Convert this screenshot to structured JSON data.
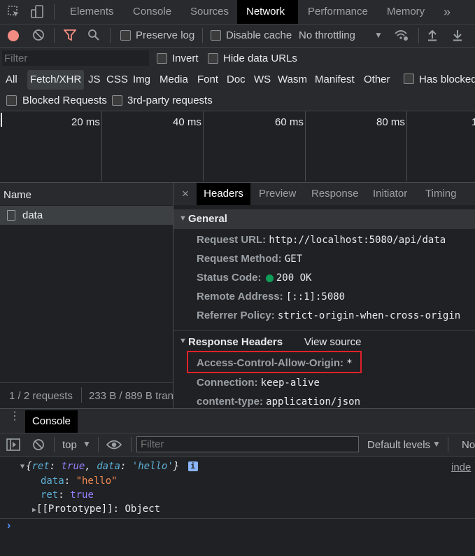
{
  "toolbar_tabs": [
    "Elements",
    "Console",
    "Sources",
    "Network",
    "Performance",
    "Memory"
  ],
  "more_tabs_glyph": "»",
  "network_toolbar": {
    "preserve_log": "Preserve log",
    "disable_cache": "Disable cache",
    "throttling": "No throttling"
  },
  "filter_bar": {
    "placeholder": "Filter",
    "invert": "Invert",
    "hide_data_urls": "Hide data URLs"
  },
  "type_filters": [
    "All",
    "Fetch/XHR",
    "JS",
    "CSS",
    "Img",
    "Media",
    "Font",
    "Doc",
    "WS",
    "Wasm",
    "Manifest",
    "Other"
  ],
  "active_type_filter": "Fetch/XHR",
  "has_blocked": "Has blocked",
  "blocked_requests": "Blocked Requests",
  "third_party": "3rd-party requests",
  "timeline_ticks": [
    "20 ms",
    "40 ms",
    "60 ms",
    "80 ms",
    "1"
  ],
  "request_list": {
    "header": "Name",
    "items": [
      "data"
    ],
    "status": "1 / 2 requests",
    "transfer": "233 B / 889 B tran"
  },
  "detail_tabs": [
    "Headers",
    "Preview",
    "Response",
    "Initiator",
    "Timing"
  ],
  "close_glyph": "×",
  "general": {
    "title": "General",
    "rows": [
      {
        "key": "Request URL:",
        "value": "http://localhost:5080/api/data"
      },
      {
        "key": "Request Method:",
        "value": "GET"
      },
      {
        "key": "Status Code:",
        "value": "200 OK"
      },
      {
        "key": "Remote Address:",
        "value": "[::1]:5080"
      },
      {
        "key": "Referrer Policy:",
        "value": "strict-origin-when-cross-origin"
      }
    ]
  },
  "response_headers": {
    "title": "Response Headers",
    "view_source": "View source",
    "rows": [
      {
        "key": "Access-Control-Allow-Origin:",
        "value": "*"
      },
      {
        "key": "Connection:",
        "value": "keep-alive"
      },
      {
        "key": "content-type:",
        "value": "application/json"
      }
    ]
  },
  "drawer": {
    "tab": "Console",
    "context": "top",
    "filter_placeholder": "Filter",
    "levels": "Default levels",
    "right_truncated": "No"
  },
  "console_output": {
    "summary_open": "{",
    "k1": "ret",
    "v1": "true",
    "k2": "data",
    "v2": "'hello'",
    "summary_close": "}",
    "info_badge": "i",
    "source_link": "inde",
    "props": [
      {
        "key": "data",
        "sep": ": ",
        "value": "\"hello\"",
        "value_color": "#f28b54"
      },
      {
        "key": "ret",
        "sep": ": ",
        "value": "true",
        "value_color": "#9980ff"
      }
    ],
    "prototype": "[[Prototype]]: Object"
  },
  "colors": {
    "status_green": "#0f9d58",
    "highlight_box": "#e0202a",
    "record_red": "#f28b82",
    "console_key": "#5db0d7",
    "console_string": "#f28b54",
    "console_bool": "#9980ff",
    "prompt": "#4d8ffb"
  }
}
